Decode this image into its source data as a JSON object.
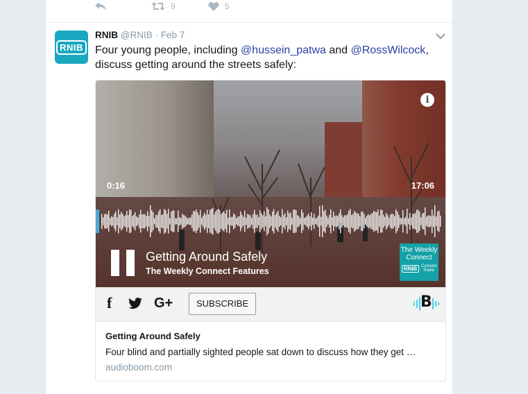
{
  "previous_tweet": {
    "actions": [
      {
        "icon": "reply-icon",
        "count": ""
      },
      {
        "icon": "retweet-icon",
        "count": "9"
      },
      {
        "icon": "like-icon",
        "count": "5"
      }
    ]
  },
  "tweet": {
    "avatar_text": "RNIB",
    "name": "RNIB",
    "handle": "@RNIB",
    "separator": "·",
    "date": "Feb 7",
    "text_1": "Four young people, including ",
    "mention_1": "@hussein_patwa",
    "text_2": "  and ",
    "mention_2": "@RossWilcock",
    "text_3": ",",
    "text_4": "discuss getting around the streets safely:"
  },
  "player": {
    "current_time": "0:16",
    "duration": "17:06",
    "info_icon": "i",
    "episode_title": "Getting Around Safely",
    "show_name": "The Weekly Connect Features",
    "progress": 0.016,
    "logo_line1": "The Weekly",
    "logo_line2": "Connect",
    "logo_badge": "RNIB",
    "logo_sub1": "Connect",
    "logo_sub2": "Radio",
    "share_facebook": "f",
    "share_google": "G+",
    "subscribe_label": "SUBSCRIBE",
    "brand_letter": "B"
  },
  "card_meta": {
    "title": "Getting Around Safely",
    "description": "Four blind and partially sighted people sat down to discuss how they get …",
    "domain": "audioboom.com"
  }
}
